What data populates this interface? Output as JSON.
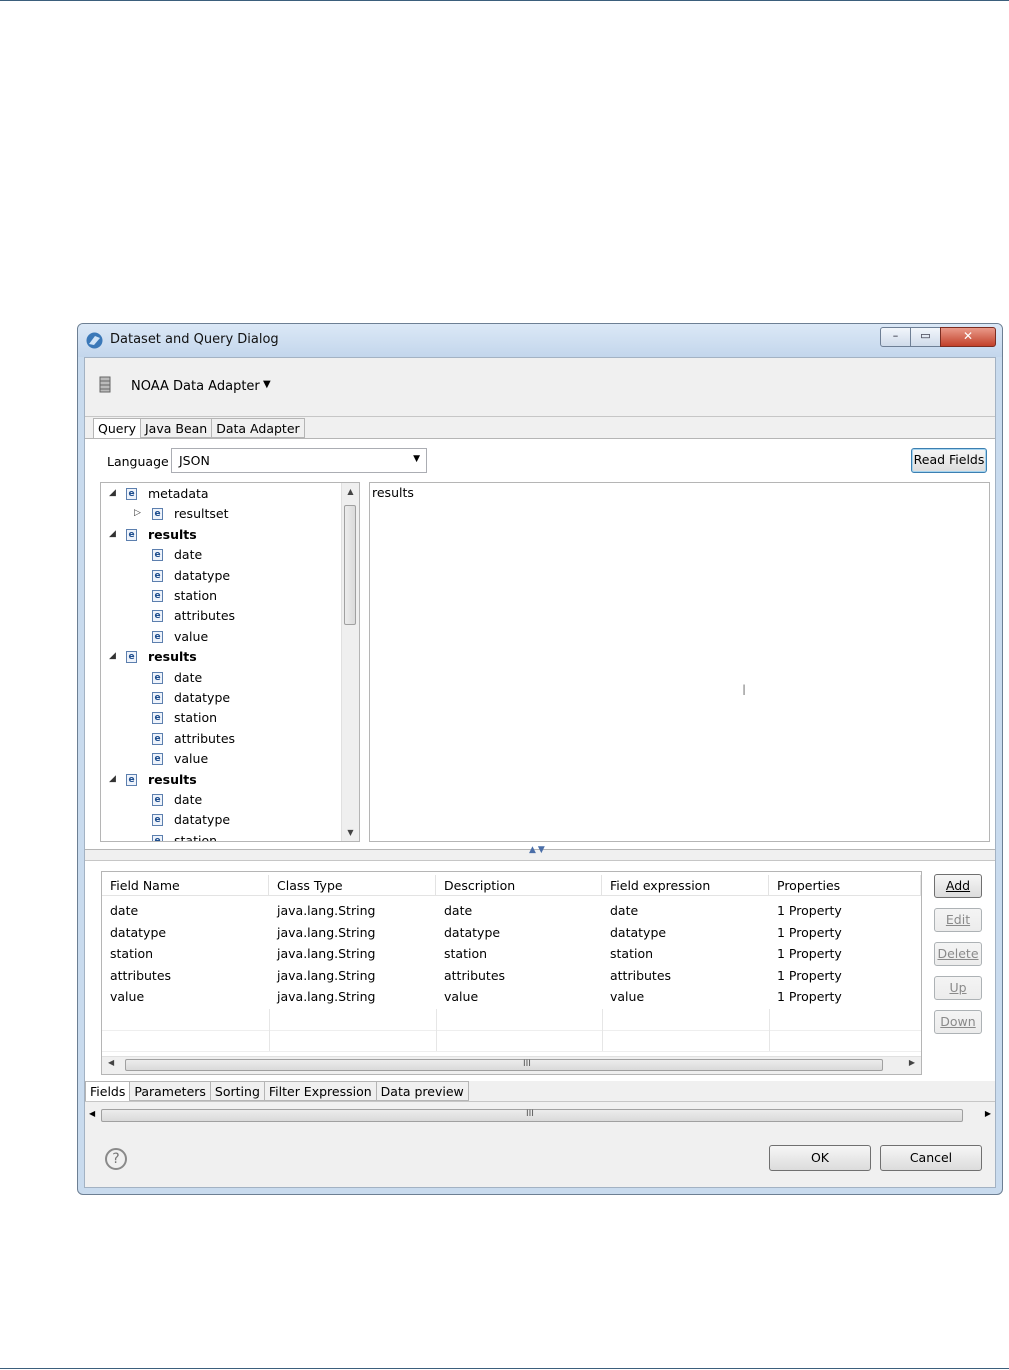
{
  "dialog": {
    "title": "Dataset and Query Dialog",
    "window_buttons": {
      "minimize": "–",
      "maximize": "▭",
      "close": "✕"
    },
    "adapter": {
      "name": "NOAA Data Adapter",
      "caret": "▼"
    },
    "top_tabs": [
      "Query",
      "Java Bean",
      "Data Adapter"
    ],
    "language": {
      "label": "Language",
      "value": "JSON"
    },
    "read_fields_label": "Read Fields",
    "tree": [
      {
        "label": "metadata",
        "bold": false,
        "level": 0,
        "expander": "◢"
      },
      {
        "label": "resultset",
        "bold": false,
        "level": 1,
        "expander": "▷"
      },
      {
        "label": "results",
        "bold": true,
        "level": 0,
        "expander": "◢"
      },
      {
        "label": "date",
        "bold": false,
        "level": 1,
        "expander": ""
      },
      {
        "label": "datatype",
        "bold": false,
        "level": 1,
        "expander": ""
      },
      {
        "label": "station",
        "bold": false,
        "level": 1,
        "expander": ""
      },
      {
        "label": "attributes",
        "bold": false,
        "level": 1,
        "expander": ""
      },
      {
        "label": "value",
        "bold": false,
        "level": 1,
        "expander": ""
      },
      {
        "label": "results",
        "bold": true,
        "level": 0,
        "expander": "◢"
      },
      {
        "label": "date",
        "bold": false,
        "level": 1,
        "expander": ""
      },
      {
        "label": "datatype",
        "bold": false,
        "level": 1,
        "expander": ""
      },
      {
        "label": "station",
        "bold": false,
        "level": 1,
        "expander": ""
      },
      {
        "label": "attributes",
        "bold": false,
        "level": 1,
        "expander": ""
      },
      {
        "label": "value",
        "bold": false,
        "level": 1,
        "expander": ""
      },
      {
        "label": "results",
        "bold": true,
        "level": 0,
        "expander": "◢"
      },
      {
        "label": "date",
        "bold": false,
        "level": 1,
        "expander": ""
      },
      {
        "label": "datatype",
        "bold": false,
        "level": 1,
        "expander": ""
      },
      {
        "label": "station",
        "bold": false,
        "level": 1,
        "expander": ""
      }
    ],
    "tree_icon_letter": "e",
    "query_text": "results",
    "fields_table": {
      "columns": [
        "Field Name",
        "Class Type",
        "Description",
        "Field expression",
        "Properties"
      ],
      "rows": [
        [
          "date",
          "java.lang.String",
          "date",
          "date",
          "1 Property"
        ],
        [
          "datatype",
          "java.lang.String",
          "datatype",
          "datatype",
          "1 Property"
        ],
        [
          "station",
          "java.lang.String",
          "station",
          "station",
          "1 Property"
        ],
        [
          "attributes",
          "java.lang.String",
          "attributes",
          "attributes",
          "1 Property"
        ],
        [
          "value",
          "java.lang.String",
          "value",
          "value",
          "1 Property"
        ]
      ]
    },
    "side_buttons": [
      {
        "label": "Add",
        "enabled": true
      },
      {
        "label": "Edit",
        "enabled": false
      },
      {
        "label": "Delete",
        "enabled": false
      },
      {
        "label": "Up",
        "enabled": false
      },
      {
        "label": "Down",
        "enabled": false
      }
    ],
    "bottom_tabs": [
      "Fields",
      "Parameters",
      "Sorting",
      "Filter Expression",
      "Data preview"
    ],
    "ok_label": "OK",
    "cancel_label": "Cancel",
    "help_glyph": "?"
  }
}
